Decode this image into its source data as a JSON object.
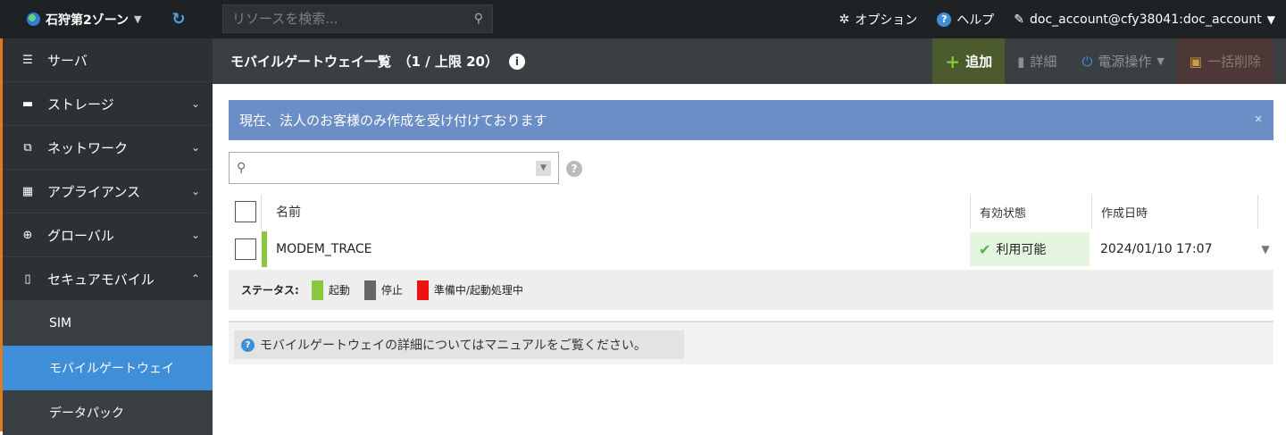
{
  "topbar": {
    "zone_label": "石狩第2ゾーン",
    "search_placeholder": "リソースを検索...",
    "options_label": "オプション",
    "help_label": "ヘルプ",
    "account_label": "doc_account@cfy38041:doc_account"
  },
  "sidebar": {
    "items": [
      {
        "label": "サーバ",
        "icon": "server-icon",
        "expandable": false
      },
      {
        "label": "ストレージ",
        "icon": "storage-icon",
        "expandable": true
      },
      {
        "label": "ネットワーク",
        "icon": "network-icon",
        "expandable": true
      },
      {
        "label": "アプライアンス",
        "icon": "appliance-icon",
        "expandable": true
      },
      {
        "label": "グローバル",
        "icon": "globe-icon",
        "expandable": true
      },
      {
        "label": "セキュアモバイル",
        "icon": "mobile-icon",
        "expandable": true,
        "expanded": true
      }
    ],
    "subitems": [
      {
        "label": "SIM",
        "active": false
      },
      {
        "label": "モバイルゲートウェイ",
        "active": true
      },
      {
        "label": "データパック",
        "active": false
      }
    ]
  },
  "header": {
    "title": "モバイルゲートウェイ一覧　（1 / 上限 20）",
    "actions": {
      "add": "追加",
      "detail": "詳細",
      "power": "電源操作",
      "bulk_delete": "一括削除"
    }
  },
  "notice": {
    "text": "現在、法人のお客様のみ作成を受け付けております",
    "close": "×"
  },
  "table": {
    "columns": {
      "name": "名前",
      "state": "有効状態",
      "created": "作成日時"
    },
    "rows": [
      {
        "name": "MODEM_TRACE",
        "state": "利用可能",
        "created": "2024/01/10 17:07",
        "status_color": "#8cc63f"
      }
    ]
  },
  "legend": {
    "title": "ステータス:",
    "items": [
      {
        "label": "起動",
        "color": "#8cc63f"
      },
      {
        "label": "停止",
        "color": "#666666"
      },
      {
        "label": "準備中/起動処理中",
        "color": "#ee1111"
      }
    ]
  },
  "manual": {
    "text": "モバイルゲートウェイの詳細についてはマニュアルをご覧ください。"
  }
}
